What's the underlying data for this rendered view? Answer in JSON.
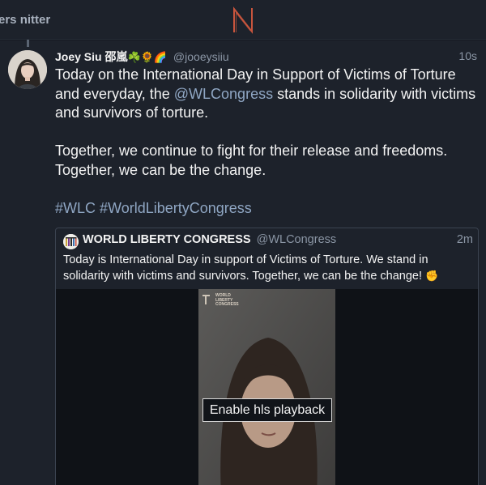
{
  "topbar": {
    "nav_link": "ers nitter"
  },
  "tweet": {
    "fullname": "Joey Siu 邵嵐",
    "name_emojis": "☘️🌻🌈",
    "username": "@jooeysiiu",
    "time": "10s",
    "p1_a": "Today on the International Day in Support of Victims of Torture and everyday, the ",
    "p1_mention": "@WLCongress",
    "p1_b": " stands in solidarity with victims and survivors of torture.",
    "p2": "Together, we continue to fight for their release and freedoms. Together, we can be the change.",
    "hashtag1": "#WLC",
    "hashtag2": "#WorldLibertyCongress"
  },
  "quote": {
    "fullname": "WORLD LIBERTY CONGRESS",
    "username": "@WLCongress",
    "time": "2m",
    "text": "Today is International Day in support of Victims of Torture. We stand in solidarity with victims and survivors. Together, we can be the change! ",
    "fist_emoji": "✊",
    "video": {
      "watermark_line1": "WORLD",
      "watermark_line2": "LIBERTY",
      "watermark_line3": "CONGRESS",
      "button_label": "Enable hls playback"
    }
  },
  "colors": {
    "background": "#1d222b",
    "accent": "#ff6c60",
    "link": "#8fa6c3",
    "muted": "#8b96a5"
  }
}
